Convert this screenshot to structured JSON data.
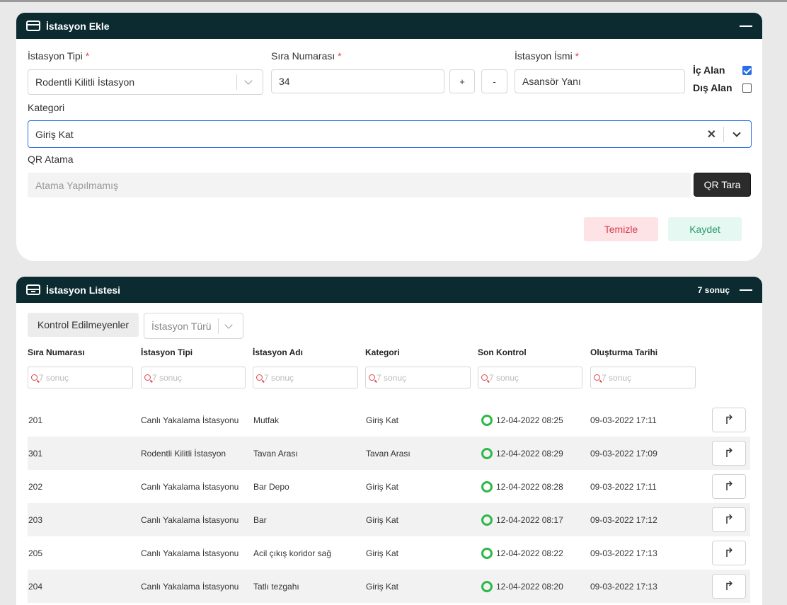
{
  "add_panel": {
    "title": "İstasyon Ekle",
    "station_type": {
      "label": "İstasyon Tipi",
      "required_mark": "*",
      "value": "Rodentli Kilitli İstasyon"
    },
    "order_number": {
      "label": "Sıra Numarası",
      "required_mark": "*",
      "value": "34",
      "plus": "+",
      "minus": "-"
    },
    "station_name": {
      "label": "İstasyon İsmi",
      "required_mark": "*",
      "value": "Asansör Yanı"
    },
    "indoor": {
      "label": "İç Alan",
      "checked": true
    },
    "outdoor": {
      "label": "Dış Alan",
      "checked": false
    },
    "category": {
      "label": "Kategori",
      "value": "Giriş Kat",
      "clear": "✕"
    },
    "qr": {
      "label": "QR Atama",
      "placeholder": "Atama Yapılmamış",
      "button": "QR Tara"
    },
    "clear_button": "Temizle",
    "save_button": "Kaydet"
  },
  "list_panel": {
    "title": "İstasyon Listesi",
    "count": "7 sonuç",
    "filters": {
      "unchecked": "Kontrol Edilmeyenler",
      "station_type": "İstasyon Türü"
    },
    "columns": [
      "Sıra Numarası",
      "İstasyon Tipi",
      "İstasyon Adı",
      "Kategori",
      "Son Kontrol",
      "Oluşturma Tarihi"
    ],
    "search_placeholder": "7 sonuç",
    "rows": [
      {
        "no": "201",
        "type": "Canlı Yakalama İstasyonu",
        "name": "Mutfak",
        "category": "Giriş Kat",
        "last_check": "12-04-2022 08:25",
        "created": "09-03-2022 17:11"
      },
      {
        "no": "301",
        "type": "Rodentli Kilitli İstasyon",
        "name": "Tavan Arası",
        "category": "Tavan Arası",
        "last_check": "12-04-2022 08:29",
        "created": "09-03-2022 17:09"
      },
      {
        "no": "202",
        "type": "Canlı Yakalama İstasyonu",
        "name": "Bar Depo",
        "category": "Giriş Kat",
        "last_check": "12-04-2022 08:28",
        "created": "09-03-2022 17:11"
      },
      {
        "no": "203",
        "type": "Canlı Yakalama İstasyonu",
        "name": "Bar",
        "category": "Giriş Kat",
        "last_check": "12-04-2022 08:17",
        "created": "09-03-2022 17:12"
      },
      {
        "no": "205",
        "type": "Canlı Yakalama İstasyonu",
        "name": "Acil çıkış koridor sağ",
        "category": "Giriş Kat",
        "last_check": "12-04-2022 08:22",
        "created": "09-03-2022 17:13"
      },
      {
        "no": "204",
        "type": "Canlı Yakalama İstasyonu",
        "name": "Tatlı tezgahı",
        "category": "Giriş Kat",
        "last_check": "12-04-2022 08:20",
        "created": "09-03-2022 17:13"
      }
    ]
  },
  "colors": {
    "header": "#0c2b31",
    "status_ok": "#2eb84a",
    "accent": "#2a6ee8",
    "danger": "#d8394a",
    "success": "#2b9a6e"
  },
  "icons": {
    "panel": "card-icon",
    "list": "archive-icon",
    "row_action": "share-arrow-icon",
    "search": "search-icon"
  }
}
